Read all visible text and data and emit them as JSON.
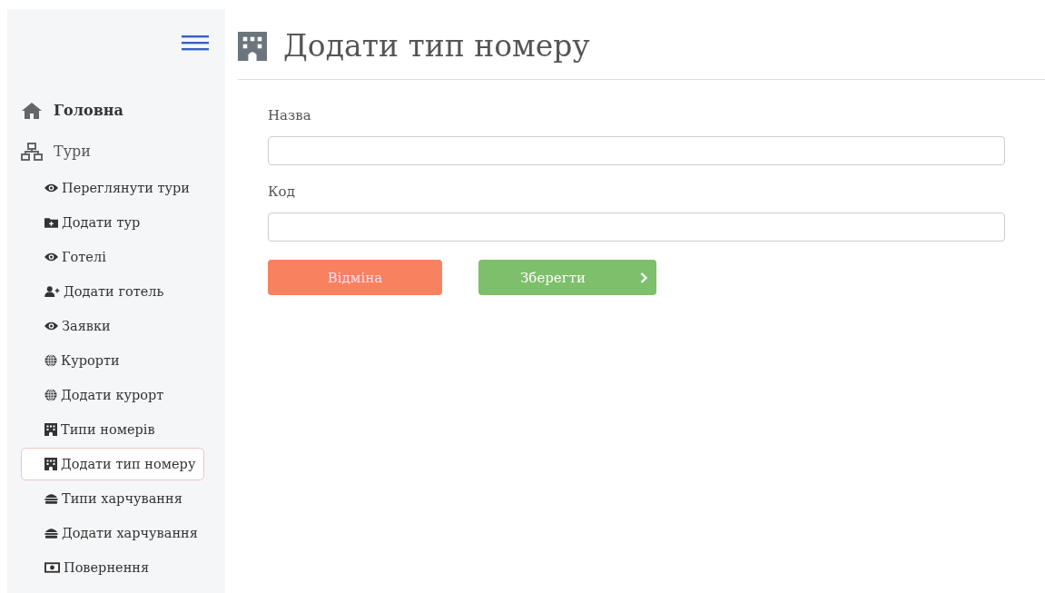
{
  "sidebar": {
    "items": [
      {
        "label": "Головна",
        "bold": true
      },
      {
        "label": "Тури",
        "bold": false,
        "children": [
          {
            "label": "Переглянути тури",
            "selected": false
          },
          {
            "label": "Додати тур",
            "selected": false
          },
          {
            "label": "Готелі",
            "selected": false
          },
          {
            "label": "Додати готель",
            "selected": false
          },
          {
            "label": "Заявки",
            "selected": false
          },
          {
            "label": "Курорти",
            "selected": false
          },
          {
            "label": "Додати курорт",
            "selected": false
          },
          {
            "label": "Типи номерів",
            "selected": false
          },
          {
            "label": "Додати тип номеру",
            "selected": true
          },
          {
            "label": "Типи харчування",
            "selected": false
          },
          {
            "label": "Додати харчування",
            "selected": false
          },
          {
            "label": "Повернення",
            "selected": false
          }
        ]
      }
    ]
  },
  "page": {
    "title": "Додати тип номеру",
    "fields": [
      {
        "label": "Назва"
      },
      {
        "label": "Код"
      }
    ],
    "buttons": [
      {
        "label": "Відміна",
        "kind": "cancel"
      },
      {
        "label": "Зберегти",
        "kind": "save"
      }
    ]
  }
}
